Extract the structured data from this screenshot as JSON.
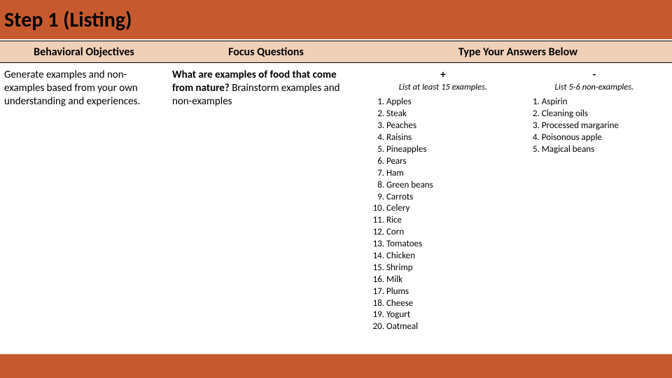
{
  "title": "Step 1 (Listing)",
  "headers": {
    "objectives": "Behavioral Objectives",
    "focus": "Focus Questions",
    "answers": "Type Your Answers Below"
  },
  "objectives_text": "Generate examples and non-examples based from your own understanding and experiences.",
  "focus_bold": "What are examples of food that come from nature?",
  "focus_rest": "Brainstorm examples and non-examples",
  "answers": {
    "positive": {
      "symbol": "+",
      "instruction": "List at least 15 examples.",
      "items": [
        "Apples",
        "Steak",
        "Peaches",
        "Raisins",
        "Pineapples",
        "Pears",
        "Ham",
        "Green beans",
        "Carrots",
        "Celery",
        "Rice",
        "Corn",
        "Tomatoes",
        "Chicken",
        "Shrimp",
        "Milk",
        "Plums",
        "Cheese",
        "Yogurt",
        "Oatmeal"
      ]
    },
    "negative": {
      "symbol": "-",
      "instruction": "List 5-6 non-examples.",
      "items": [
        "Aspirin",
        "Cleaning oils",
        "Processed margarine",
        "Poisonous apple",
        "Magical beans"
      ]
    }
  }
}
